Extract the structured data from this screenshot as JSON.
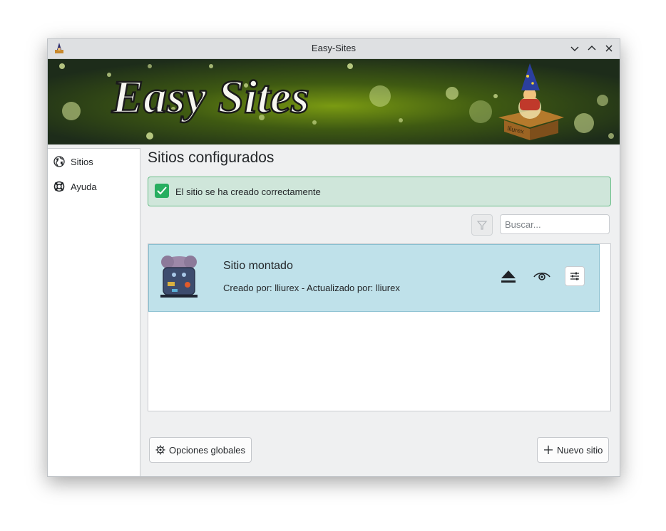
{
  "window": {
    "title": "Easy-Sites"
  },
  "banner": {
    "logo_text": "Easy Sites",
    "box_text": "lliurex"
  },
  "sidebar": {
    "items": [
      {
        "label": "Sitios",
        "icon": "globe-icon"
      },
      {
        "label": "Ayuda",
        "icon": "lifebuoy-icon"
      }
    ]
  },
  "main": {
    "title": "Sitios configurados",
    "message": "El sitio se ha creado correctamente",
    "search_placeholder": "Buscar...",
    "sites": [
      {
        "name": "Sitio montado",
        "meta": "Creado por: lliurex - Actualizado por: lliurex"
      }
    ]
  },
  "footer": {
    "global_options": "Opciones globales",
    "new_site": "Nuevo sitio"
  },
  "colors": {
    "success_bg": "#cfe6da",
    "success_border": "#6cbf8a",
    "selection": "#bfe1ea",
    "accent_green": "#27ae60"
  }
}
